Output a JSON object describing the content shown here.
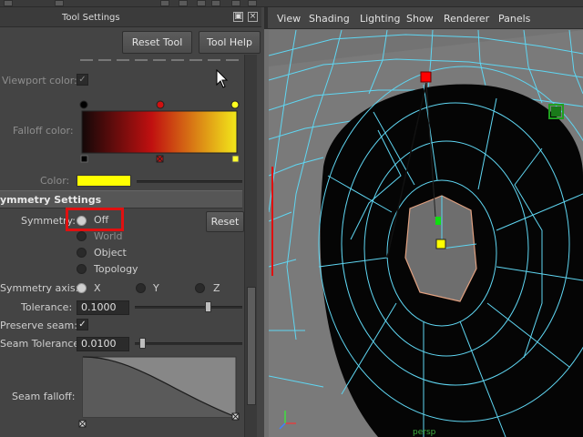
{
  "panel": {
    "title": "Tool Settings",
    "reset_tool": "Reset Tool",
    "tool_help": "Tool Help",
    "viewport_color_label": "Viewport color:",
    "falloff_color_label": "Falloff color:",
    "color_label": "Color:",
    "color_swatch": "#ffff00",
    "section_title": "ymmetry Settings",
    "symmetry_label": "Symmetry:",
    "symmetry_options": [
      "Off",
      "World",
      "Object",
      "Topology"
    ],
    "symmetry_selected": "Off",
    "reset_label": "Reset",
    "axis_label": "Symmetry axis:",
    "axis_options": [
      "X",
      "Y",
      "Z"
    ],
    "tolerance_label": "Tolerance:",
    "tolerance_value": "0.1000",
    "preserve_seam_label": "Preserve seam:",
    "seam_tolerance_label": "Seam Tolerance:",
    "seam_tolerance_value": "0.0100",
    "seam_falloff_label": "Seam falloff:"
  },
  "viewport": {
    "menus": [
      "View",
      "Shading",
      "Lighting",
      "Show",
      "Renderer",
      "Panels"
    ],
    "camera_label": "persp"
  },
  "colors": {
    "highlight": "#e01010",
    "wire": "#5fd6f2",
    "mesh": "#050505"
  }
}
